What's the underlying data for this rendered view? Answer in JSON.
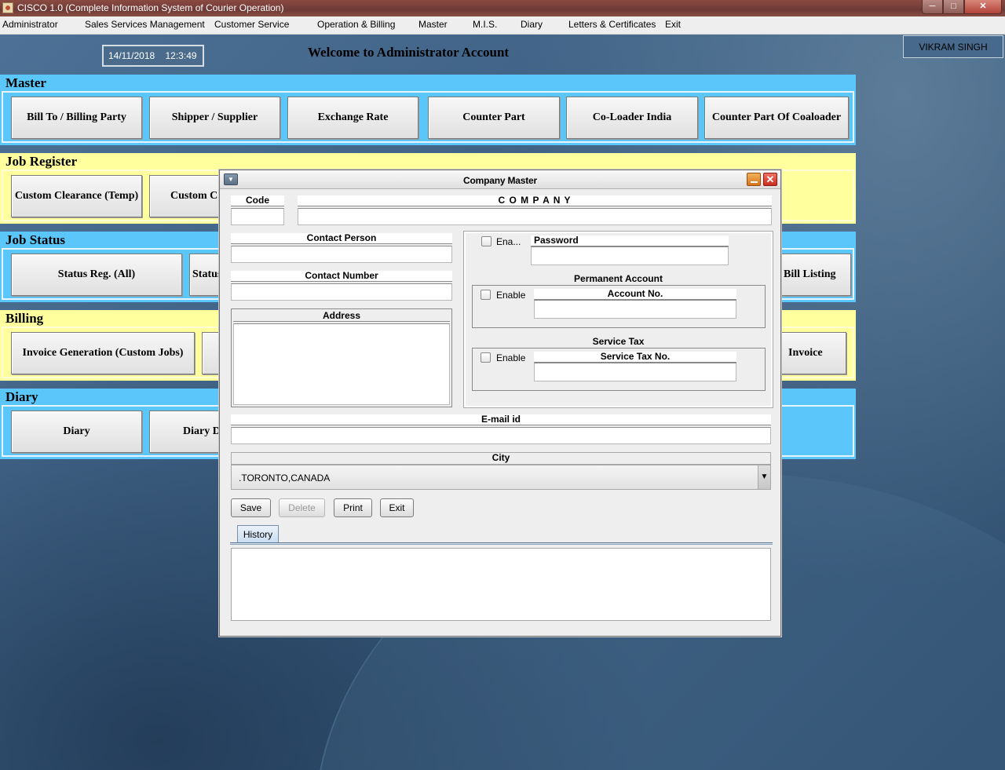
{
  "window": {
    "title": "CISCO 1.0 (Complete Information System of Courier Operation)",
    "min": "─",
    "max": "□",
    "close": "✕"
  },
  "menu": {
    "administrator": "Administrator",
    "sales": "Sales Services Management",
    "customer_service": "Customer Service",
    "operation_billing": "Operation & Billing",
    "master": "Master",
    "mis": "M.I.S.",
    "diary": "Diary",
    "letters": "Letters & Certificates",
    "exit": "Exit"
  },
  "header": {
    "datetime": "14/11/2018    12:3:49",
    "welcome": "Welcome to Administrator Account",
    "username": "VIKRAM SINGH"
  },
  "sections": {
    "master": {
      "title": "Master",
      "buttons": [
        "Bill To / Billing Party",
        "Shipper / Supplier",
        "Exchange Rate",
        "Counter Part",
        "Co-Loader India",
        "Counter Part Of Coaloader"
      ]
    },
    "job_register": {
      "title": "Job Register",
      "buttons": [
        "Custom Clearance (Temp)",
        "Custom C"
      ]
    },
    "job_status": {
      "title": "Job Status",
      "buttons": [
        "Status Reg. (All)",
        "Status",
        "Bill Listing"
      ]
    },
    "billing": {
      "title": "Billing",
      "buttons": [
        "Invoice Generation (Custom Jobs)",
        "",
        "Invoice"
      ]
    },
    "diary": {
      "title": "Diary",
      "buttons": [
        "Diary",
        "Diary D"
      ]
    }
  },
  "dialog": {
    "title": "Company Master",
    "menu_glyph": "▼",
    "close_glyph": "✕",
    "code_label": "Code",
    "code_value": "",
    "company_label": "C O M P A N Y",
    "company_value": "",
    "contact_person_label": "Contact Person",
    "contact_person_value": "",
    "contact_number_label": "Contact Number",
    "contact_number_value": "",
    "address_label": "Address",
    "address_value": "",
    "enable_short": "Ena...",
    "password_label": "Password",
    "password_value": "",
    "permanent_account_title": "Permanent Account",
    "enable_label": "Enable",
    "account_no_label": "Account No.",
    "account_no_value": "",
    "service_tax_title": "Service Tax",
    "service_tax_no_label": "Service Tax No.",
    "service_tax_no_value": "",
    "email_label": "E-mail id",
    "email_value": "",
    "city_label": "City",
    "city_value": ".TORONTO,CANADA",
    "city_arrow": "▼",
    "buttons": {
      "save": "Save",
      "delete": "Delete",
      "print": "Print",
      "exit": "Exit"
    },
    "history_tab": "History"
  }
}
